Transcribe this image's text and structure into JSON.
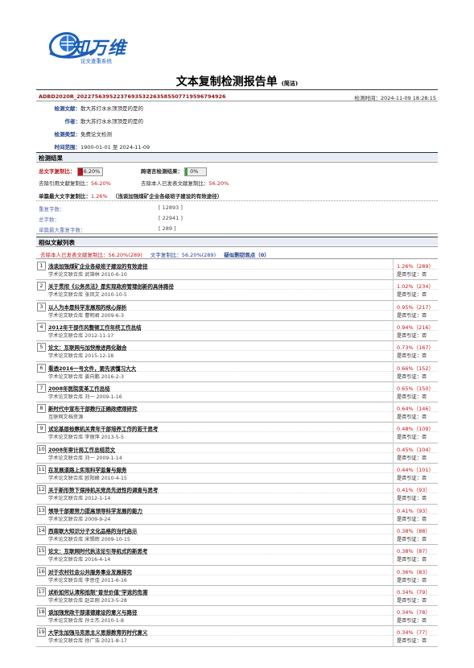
{
  "brand": {
    "name": "知万维",
    "subtitle": "论文查重系统"
  },
  "header": {
    "title": "文本复制检测报告单",
    "title_note": "(简洁)",
    "doc_id": "ADBD2020R_2022756395223769353226358550771959679492​6",
    "check_time": "检测时间：2024-11-09 18:28:15"
  },
  "meta": [
    {
      "label": "检测文献：",
      "value": "散大苏打水水顶顶是的是的"
    },
    {
      "label": "作者：",
      "value": "散大苏打水水顶顶是的是的"
    },
    {
      "label": "检测类型：",
      "value": "免费论文检测"
    },
    {
      "label": "时间范围：",
      "value": "1900-01-01 至 2024-11-09"
    }
  ],
  "result": {
    "section_title": "检测结果",
    "total_label": "总文字复制比：",
    "total_value": "56.20%",
    "total_fraction": 0.562,
    "cross_label": "跨语言检测结果：",
    "cross_value": "0%",
    "cross_fraction": 0,
    "excl_ref_label": "去除引用文献复制比：",
    "excl_ref_value": "56.20%",
    "excl_self_label": "去除本人已发表文献复制比：",
    "excl_self_value": "56.20%",
    "max_label": "单篇最大文字复制比：",
    "max_value": "1.26%",
    "max_source": "（浅谈加强煤矿企业各级班子建设的有效途径）",
    "stats": [
      {
        "label": "重复字数：",
        "value": "[ 12893 ]"
      },
      {
        "label": "总字数：",
        "value": "[ 22941 ]"
      },
      {
        "label": "单篇最大重复字数：",
        "value": "[ 289 ]"
      }
    ]
  },
  "similar": {
    "section_title": "相似文献列表",
    "summary_a": "去除本人已发表文献复制比：56.20%(289)",
    "summary_b": "文字复制比：56.20%(289)",
    "summary_c": "疑似剽窃观点（0）",
    "cite_label": "是否引证：",
    "cite_value": "否",
    "items": [
      {
        "num": "1",
        "title": "浅谈加强煤矿企业各级班子建设的有效途径",
        "source": "学术论文联合库 武锦林 2010-6-10",
        "pct": "1.26%（289）"
      },
      {
        "num": "2",
        "title": "关于贯彻《公务员法》是实现政府管理创新的具体路径",
        "source": "学术论文联合库 张凤文 2010-10-5",
        "pct": "1.02%（234）"
      },
      {
        "num": "3",
        "title": "以人为本是科学发展观的核心探析",
        "source": "学术论文联合库 曹明君 2009-6-3",
        "pct": "0.95%（217）"
      },
      {
        "num": "4",
        "title": "2012年干部作风整顿工作年终工作总结",
        "source": "学术论文联合库 2012-11-17",
        "pct": "0.94%（216）"
      },
      {
        "num": "5",
        "title": "论文：互联网与加快推进两化融合",
        "source": "学术论文联合库 2015-12-18",
        "pct": "0.73%（167）"
      },
      {
        "num": "6",
        "title": "看透2016一号文件，要先读懂习大大",
        "source": "学术论文联合库 姜向鹏 2016-2-3",
        "pct": "0.66%（152）"
      },
      {
        "num": "7",
        "title": "2008年医院变革工作总结",
        "source": "学术论文联合库 刘一 2009-1-16",
        "pct": "0.65%（150）"
      },
      {
        "num": "8",
        "title": "新时代中宣布干部教行正确政绩观研究",
        "source": "互联网文档资源",
        "pct": "0.64%（146）"
      },
      {
        "num": "9",
        "title": "试论基层检察机关青年干部培养工作的若干思考",
        "source": "学术论文联合库 李丽萍 2013-5-5",
        "pct": "0.48%（109）"
      },
      {
        "num": "10",
        "title": "2008年审计局工作总结范文",
        "source": "学术论文联合库 刘一 2009-1-14",
        "pct": "0.45%（104）"
      },
      {
        "num": "11",
        "title": "在发展道路上实现科学监督与服务",
        "source": "学术论文联合库 欧阳峰 2010-4-15",
        "pct": "0.44%（101）"
      },
      {
        "num": "12",
        "title": "关于新形势下保持机关党员先进性的调查与思考",
        "source": "学术论文联合库 2012-1-14",
        "pct": "0.41%（93）"
      },
      {
        "num": "13",
        "title": "领导干部要努力提高领导科学发展的能力",
        "source": "学术论文联合库 2009-9-24",
        "pct": "0.41%（93）"
      },
      {
        "num": "14",
        "title": "西南联大知识分子文化品格的当代启示",
        "source": "学术论文联合库 宋锡辉 2009-10-15",
        "pct": "0.38%（88）"
      },
      {
        "num": "15",
        "title": "论文：互联网时代执法论引导机式的新思考",
        "source": "学术论文联合库 2016-4-14",
        "pct": "0.38%（87）"
      },
      {
        "num": "16",
        "title": "对于农村社会公共服务事业发展探究",
        "source": "学术论文联合库 李思佳 2011-6-16",
        "pct": "0.36%（83）"
      },
      {
        "num": "17",
        "title": "试析如何认清和抵制\"普世价值\"学说的危害",
        "source": "学术论文联合库 赵正刚 2013-5-28",
        "pct": "0.34%（79）"
      },
      {
        "num": "18",
        "title": "谈加强党政干部道德建设的意义与路径",
        "source": "学术论文联合库 孙士杰 2010-1-8",
        "pct": "0.34%（78）"
      },
      {
        "num": "19",
        "title": "大学生加强马克思主义思想教育的时代意义",
        "source": "学术论文联合库 徐广浩 2021-8-17",
        "pct": "0.34%（77）"
      }
    ]
  },
  "colors": {
    "brand": "#1a5eb8",
    "red": "#c0161a",
    "green": "#3aa33a",
    "label_blue": "#1f3f8a"
  }
}
